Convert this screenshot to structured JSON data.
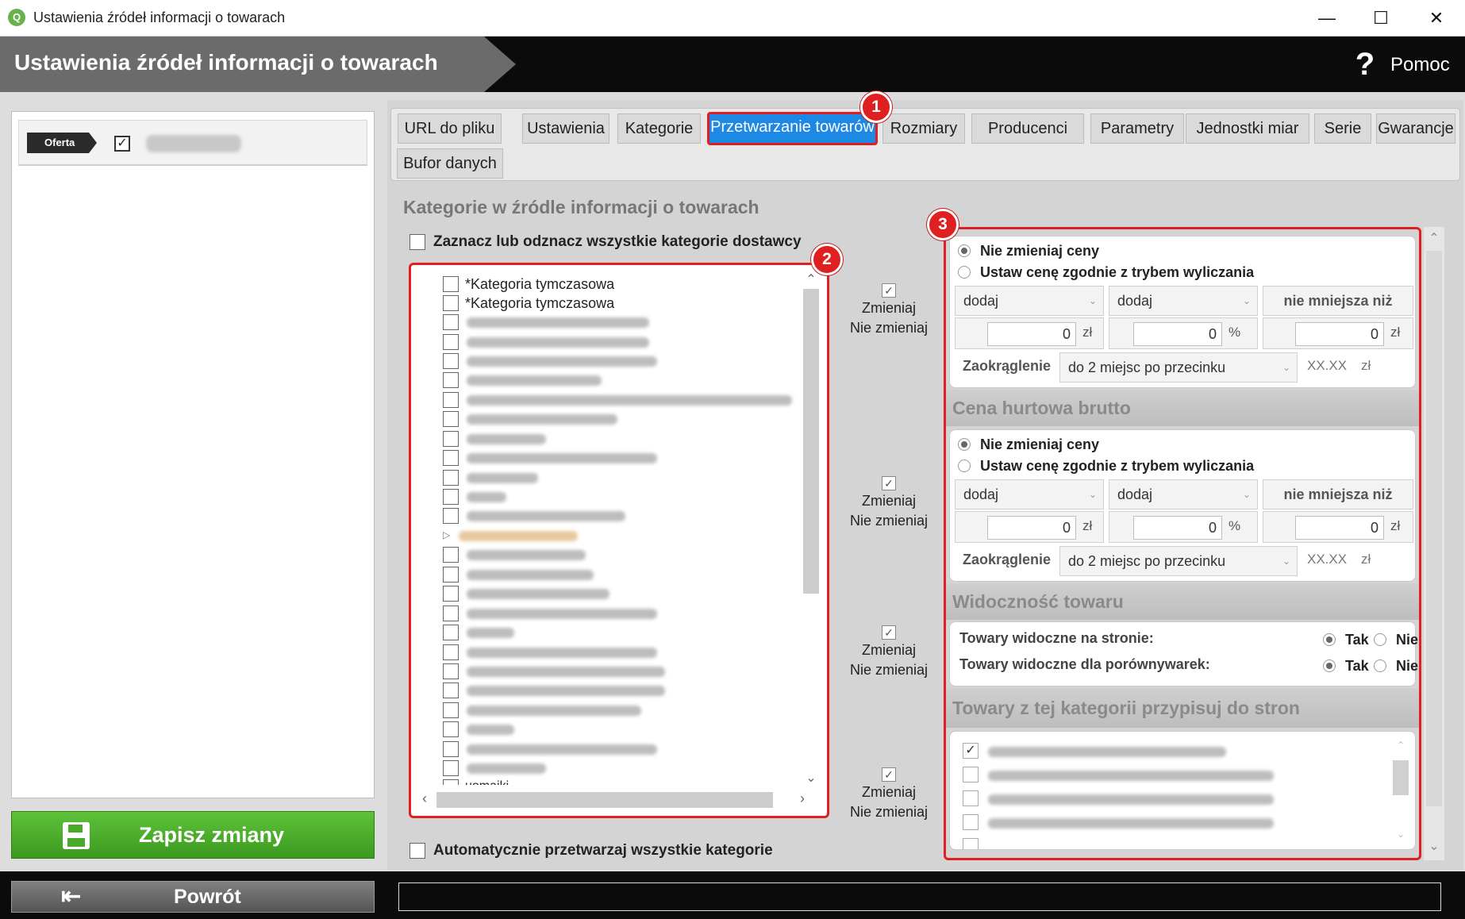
{
  "window": {
    "title": "Ustawienia źródeł informacji o towarach",
    "app_icon_glyph": "Q",
    "minimize_glyph": "—",
    "maximize_glyph": "☐",
    "close_glyph": "✕"
  },
  "header": {
    "title": "Ustawienia źródeł informacji o towarach",
    "help_glyph": "?",
    "help_label": "Pomoc"
  },
  "left": {
    "offer_tag": "Oferta",
    "offer_checked": "✓",
    "save_label": "Zapisz zmiany",
    "back_glyph": "⇤",
    "back_label": "Powrót"
  },
  "tabs": {
    "items": [
      "URL do pliku",
      "Ustawienia",
      "Kategorie",
      "Przetwarzanie towarów",
      "Rozmiary",
      "Producenci",
      "Parametry",
      "Jednostki miar",
      "Serie",
      "Gwarancje",
      "Bufor danych"
    ],
    "active_index": 3
  },
  "badges": [
    "1",
    "2",
    "3"
  ],
  "categories": {
    "section_title": "Kategorie w źródle informacji o towarach",
    "select_all_label": "Zaznacz lub odznacz wszystkie kategorie dostawcy",
    "items": [
      "*Kategoria tymczasowa",
      "*Kategoria tymczasowa"
    ],
    "last_item_fragment": "uomaiki",
    "auto_process_label": "Automatycznie przetwarzaj wszystkie kategorie"
  },
  "change_option": {
    "change": "Zmieniaj",
    "no_change": "Nie zmieniaj",
    "check": "✓"
  },
  "pricing": {
    "no_change_price": "Nie zmieniaj ceny",
    "set_price_mode": "Ustaw cenę zgodnie z trybem wyliczania",
    "op1": "dodaj",
    "op2": "dodaj",
    "min_label": "nie mniejsza niż",
    "value1": "0",
    "value2": "0",
    "value3": "0",
    "unit_zl": "zł",
    "unit_pct": "%",
    "rounding_label": "Zaokrąglenie",
    "rounding_value": "do 2 miejsc po przecinku",
    "rounding_format": "XX.XX",
    "chevron": "⌄"
  },
  "wholesale": {
    "title": "Cena hurtowa brutto"
  },
  "visibility": {
    "title": "Widoczność towaru",
    "rows": [
      {
        "label": "Towary widoczne na stronie:",
        "yes": "Tak",
        "no": "Nie"
      },
      {
        "label": "Towary widoczne dla porównywarek:",
        "yes": "Tak",
        "no": "Nie"
      }
    ]
  },
  "assign_sites": {
    "title": "Towary z tej kategorii przypisuj do stron",
    "first_checked": "✓"
  },
  "scroll": {
    "up": "⌃",
    "down": "⌄",
    "left": "‹",
    "right": "›",
    "expander": "▷"
  }
}
